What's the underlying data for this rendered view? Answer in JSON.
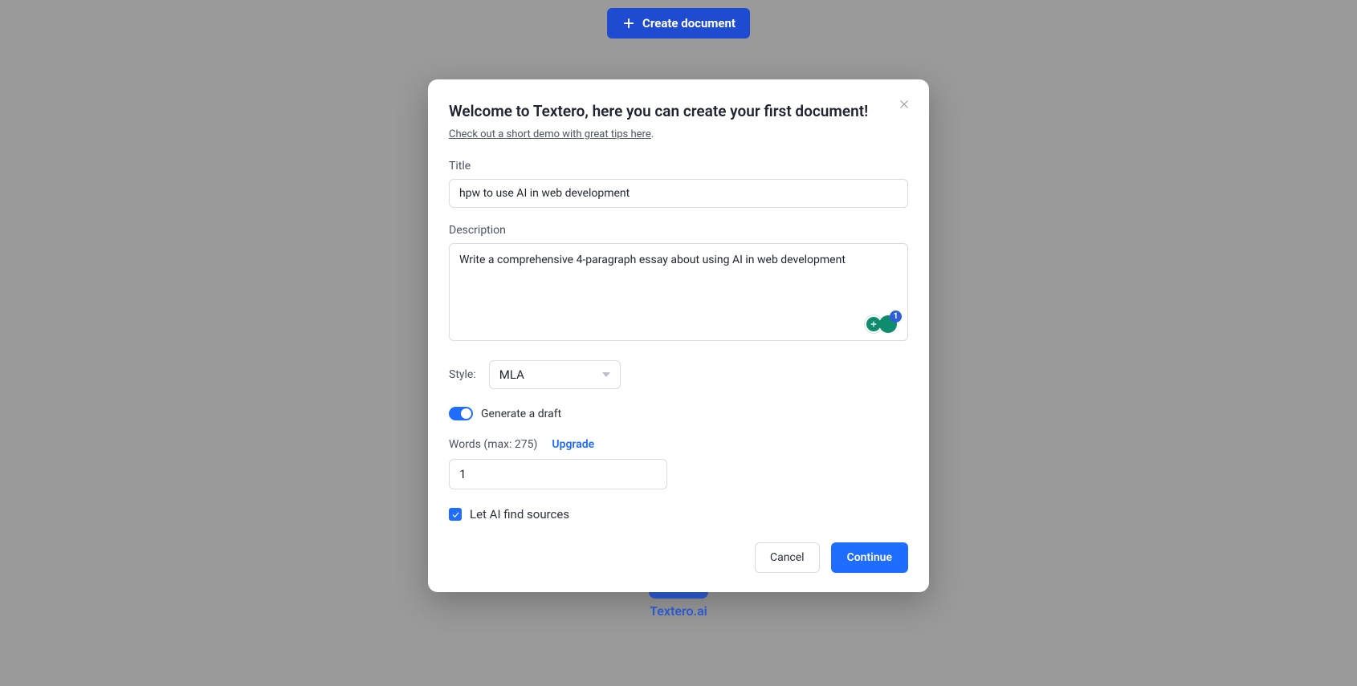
{
  "header": {
    "create_doc_label": "Create document"
  },
  "brand": {
    "name": "Textero.ai"
  },
  "modal": {
    "title": "Welcome to Textero, here you can create your first document!",
    "demo_link_text": "Check out a short demo with great tips here",
    "title_label": "Title",
    "title_value": "hpw to use AI in web development",
    "description_label": "Description",
    "description_value": "Write a comprehensive 4-paragraph essay about using AI in web development",
    "style_label": "Style:",
    "style_value": "MLA",
    "generate_draft_label": "Generate a draft",
    "generate_draft_on": true,
    "words_label": "Words (max: 275)",
    "upgrade_label": "Upgrade",
    "words_value": "1",
    "ai_sources_label": "Let AI find sources",
    "ai_sources_checked": true,
    "grammarly_count": "1",
    "cancel_label": "Cancel",
    "continue_label": "Continue"
  }
}
